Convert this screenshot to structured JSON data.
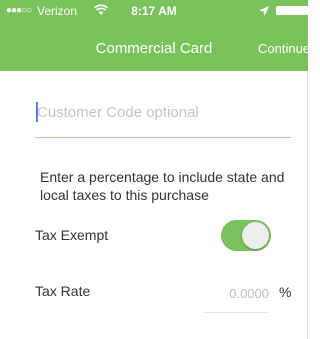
{
  "status_bar": {
    "signal": "●●●○○",
    "carrier": "Verizon",
    "time": "8:17 AM"
  },
  "nav": {
    "title": "Commercial Card",
    "continue_label": "Continue"
  },
  "form": {
    "customer_code_placeholder": "Customer Code optional",
    "tax_info_text": "Enter a percentage to include state and local taxes to this purchase",
    "tax_exempt_label": "Tax Exempt",
    "tax_exempt_on": true,
    "tax_rate_label": "Tax Rate",
    "tax_rate_placeholder": "0.0000",
    "tax_rate_unit": "%"
  },
  "colors": {
    "header_bg": "#79c25c",
    "toggle_on": "#7ac25e",
    "field_underline": "#a8d48e"
  }
}
